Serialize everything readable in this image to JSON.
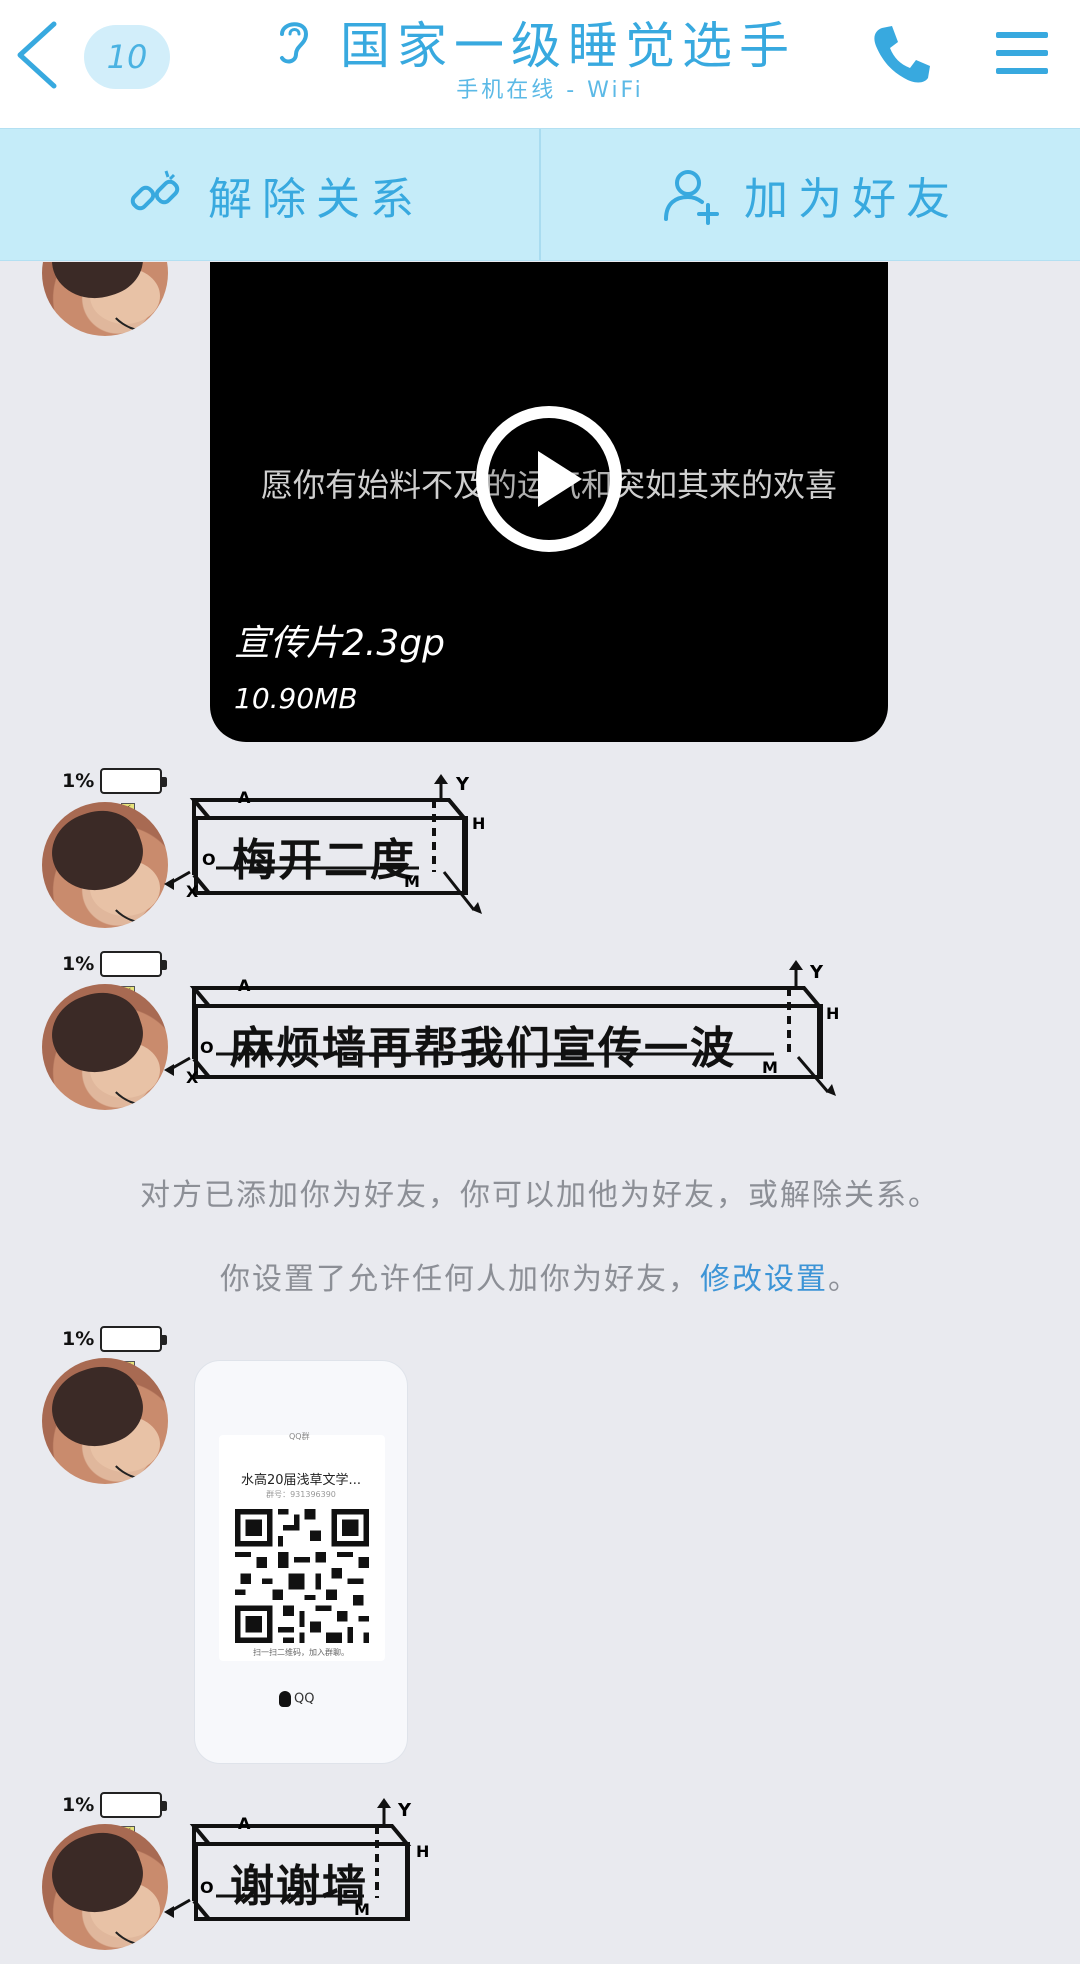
{
  "header": {
    "unread_count": "10",
    "title": "国家一级睡觉选手",
    "subtitle": "手机在线 - WiFi"
  },
  "actions": {
    "unbind_label": "解除关系",
    "add_friend_label": "加为好友"
  },
  "messages": {
    "video": {
      "caption": "愿你有始料不及的运气和突如其来的欢喜",
      "name": "宣传片2.3gp",
      "size": "10.90MB"
    },
    "battery_pct": "1%",
    "box1": "梅开二度",
    "box2": "麻烦墙再帮我们宣传一波",
    "box3": "谢谢墙",
    "box_labels": {
      "a": "A",
      "o": "O",
      "x": "X",
      "y": "Y",
      "h": "H",
      "m": "M"
    }
  },
  "notices": {
    "added": "对方已添加你为好友，你可以加他为好友，或解除关系。",
    "settings_prefix": "你设置了允许任何人加你为好友，",
    "settings_link": "修改设置",
    "settings_suffix": "。"
  },
  "qr": {
    "logo": "QQ群",
    "group_name": "水高20届浅草文学...",
    "group_number": "群号：931396390",
    "hint": "扫一扫二维码，加入群聊。",
    "brand": "QQ"
  },
  "colors": {
    "accent": "#38a9df",
    "action_bar": "#c5ecf9",
    "chat_bg": "#e9eaef",
    "link": "#3c94d6"
  }
}
